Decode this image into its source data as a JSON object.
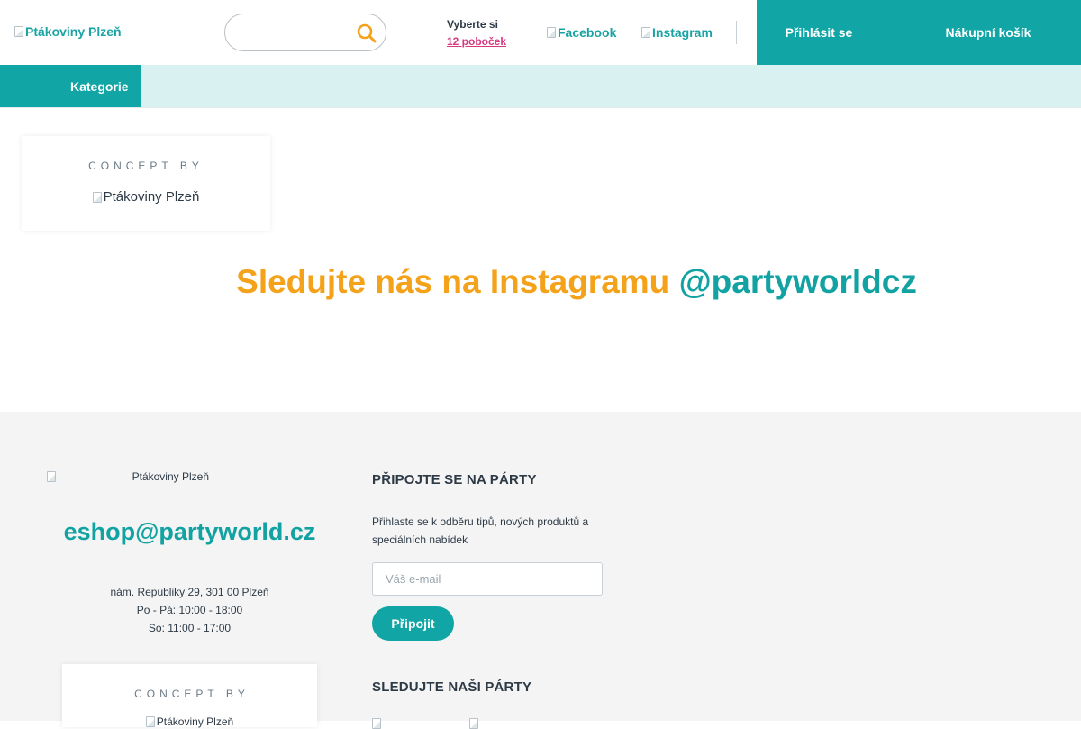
{
  "header": {
    "logo_alt": "Ptákoviny Plzeň",
    "search_placeholder": "",
    "branches_label": "Vyberte si",
    "branches_link": "12 poboček",
    "facebook_alt": "Facebook",
    "instagram_alt": "Instagram",
    "login_label": "Přihlásit se",
    "cart_label": "Nákupní košík"
  },
  "nav": {
    "categories_label": "Kategorie"
  },
  "concept_card": {
    "concept_by": "CONCEPT BY",
    "logo_alt": "Ptákoviny Plzeň"
  },
  "instagram_section": {
    "heading_text": "Sledujte nás na Instagramu",
    "heading_handle": "@partyworldcz"
  },
  "footer": {
    "logo_alt": "Ptákoviny Plzeň",
    "email": "eshop@partyworld.cz",
    "address": "nám. Republiky 29, 301 00 Plzeň",
    "hours_weekdays": "Po - Pá: 10:00 - 18:00",
    "hours_saturday": "So: 11:00 - 17:00",
    "concept_by": "CONCEPT BY",
    "concept_logo_alt": "Ptákoviny Plzeň",
    "newsletter_title": "PŘIPOJTE SE NA PÁRTY",
    "newsletter_text": "Přihlaste se k odběru tipů, nových produktů a speciálních nabídek",
    "email_placeholder": "Váš e-mail",
    "join_label": "Připojit",
    "follow_title": "SLEDUJTE NAŠI PÁRTY"
  },
  "colors": {
    "accent": "#11a5a5",
    "nav_bg": "#d9f1f1",
    "orange": "#f4a21a",
    "link_pink": "#d6397f",
    "footer_bg": "#f4f4f4"
  }
}
